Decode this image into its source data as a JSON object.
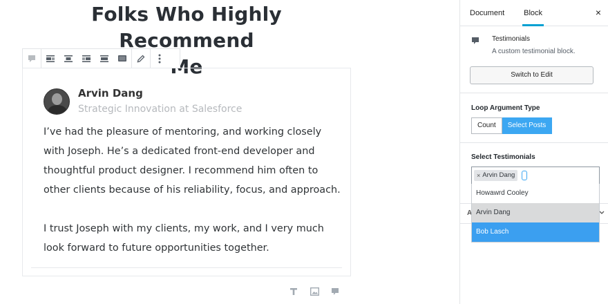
{
  "editor": {
    "heading_line1": "Folks Who Highly Recommend",
    "heading_line2": "Me",
    "testimonial": {
      "name": "Arvin Dang",
      "role": "Strategic Innovation at Salesforce",
      "paragraph1": "I’ve had the pleasure of mentoring, and working closely with Joseph. He’s a dedicated front-end developer and thoughtful product designer. I recommend him often to other clients because of his reliability, focus, and approach.",
      "paragraph2": "I trust Joseph with my clients, my work, and I very much look forward to future opportunities together."
    },
    "toolbar_icons": [
      "testimonial-block-icon",
      "align-left-icon",
      "align-center-icon",
      "align-right-icon",
      "align-wide-icon",
      "align-full-icon",
      "edit-pencil-icon",
      "more-vertical-icon"
    ],
    "inserter_icons": [
      "text-icon",
      "image-icon",
      "testimonial-icon"
    ]
  },
  "sidebar": {
    "tabs": [
      {
        "label": "Document",
        "active": false
      },
      {
        "label": "Block",
        "active": true
      }
    ],
    "close_glyph": "×",
    "block_card": {
      "title": "Testimonials",
      "description": "A custom testimonial block."
    },
    "switch_button": "Switch to Edit",
    "loop_argument": {
      "label": "Loop Argument Type",
      "options": [
        {
          "label": "Count",
          "active": false
        },
        {
          "label": "Select Posts",
          "active": true
        }
      ]
    },
    "select_testimonials": {
      "label": "Select Testimonials",
      "token_remove": "×",
      "token": "Arvin Dang",
      "suggestions": [
        {
          "label": "Howawrd Cooley",
          "state": "normal"
        },
        {
          "label": "Arvin Dang",
          "state": "hover"
        },
        {
          "label": "Bob Lasch",
          "state": "selected"
        }
      ]
    },
    "hidden_panel_peek": "A",
    "accent_color": "#3ca7f2",
    "tab_indicator_color": "#00a0d2"
  }
}
